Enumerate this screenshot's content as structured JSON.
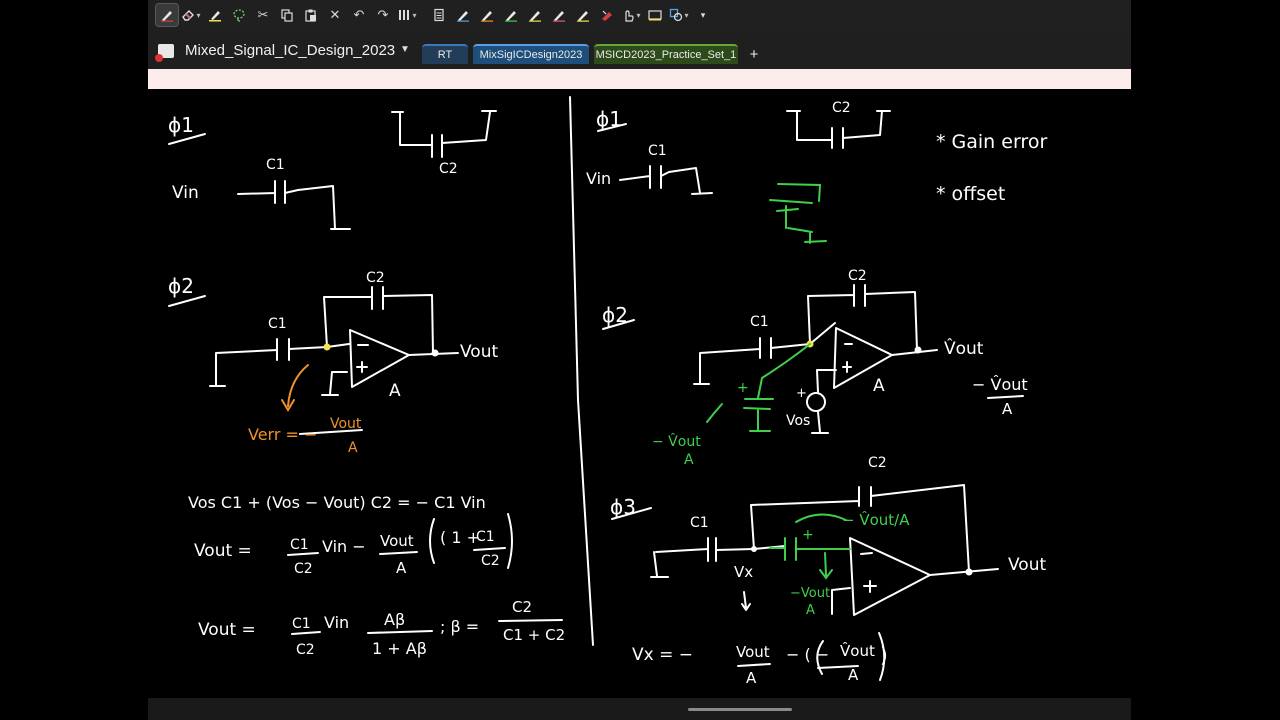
{
  "toolbar": {
    "tools": [
      "pen-tool-icon",
      "eraser-icon",
      "highlighter-icon",
      "lasso-select-icon",
      "cut-icon",
      "copy-icon",
      "paste-icon",
      "delete-icon",
      "undo-icon",
      "redo-icon",
      "pens-gallery-icon",
      "ruled-page-icon",
      "pen-black-icon",
      "pen-orange-icon",
      "pen-green-icon",
      "pen-yellow-icon",
      "pen-red-icon",
      "pen-blue-icon",
      "laser-eraser-icon",
      "touch-writing-icon",
      "insert-space-icon",
      "shapes-icon",
      "more-icon"
    ]
  },
  "notebook": {
    "title": "Mixed_Signal_IC_Design_2023",
    "tabs": [
      {
        "label": "RT"
      },
      {
        "label": "MixSigICDesign2023"
      },
      {
        "label": "MSICD2023_Practice_Set_1"
      }
    ],
    "add_tab": "+"
  },
  "colors": {
    "ink_white": "#ffffff",
    "ink_orange": "#f0922a",
    "ink_green": "#3fcf4a",
    "ink_yellow": "#f3e64a",
    "tab_rt": "#233c58",
    "tab_active": "#1e4f7a",
    "tab_practice": "#2d4a1a",
    "page_header": "#fdecec"
  },
  "notes": {
    "left": {
      "phi1": "ϕ1",
      "vin": "Vin",
      "c1_top": "C1",
      "c2_top": "C2",
      "phi2": "ϕ2",
      "c2_mid": "C2",
      "c1_mid": "C1",
      "vout_mid": "Vout",
      "gain_a": "A",
      "verr": "Verr = −",
      "verr_num": "Vout",
      "verr_den": "A",
      "eq1": "Vos C1  + (Vos − Vout) C2  =  − C1 Vin",
      "eq2_lhs": "Vout  =",
      "eq2_c1": "C1",
      "eq2_c2": "C2",
      "eq2_vin": "Vin  −",
      "eq2_vout": "Vout",
      "eq2_a": "A",
      "eq2_bracket": "( 1 +",
      "eq2_bc1": "C1",
      "eq2_bc2": "C2",
      "eq3_lhs": "Vout  =",
      "eq3_c1": "C1",
      "eq3_c2": "C2",
      "eq3_vin": "Vin",
      "eq3_ab": "Aβ",
      "eq3_1ab": "1 + Aβ",
      "eq3_beta": "; β =",
      "eq3_bc2": "C2",
      "eq3_bden": "C1 + C2"
    },
    "right": {
      "phi1": "ϕ1",
      "vin": "Vin",
      "c1_top": "C1",
      "c2_top": "C2",
      "gain_error": "* Gain error",
      "offset": "* offset",
      "phi2": "ϕ2",
      "c2_mid": "C2",
      "c1_mid": "C1",
      "vout_hat": "V̂out",
      "gain_a": "A",
      "minus_vout_hat": "− V̂out",
      "minus_vout_den": "A",
      "vos": "Vos",
      "plus": "+",
      "green_num": "− V̂out",
      "green_den": "A",
      "phi3": "ϕ3",
      "c2_low": "C2",
      "c1_low": "C1",
      "green_fb": "− V̂out/A",
      "vx": "Vx",
      "green_vout": "−Vout",
      "green_a": "A",
      "vout_low": "Vout",
      "eq_vx": "Vx  =  −",
      "eq_vout": "Vout",
      "eq_a": "A",
      "eq_rest": "− ( −",
      "eq_vhat": "V̂out",
      "eq_a2": "A",
      "eq_close": ")"
    }
  }
}
